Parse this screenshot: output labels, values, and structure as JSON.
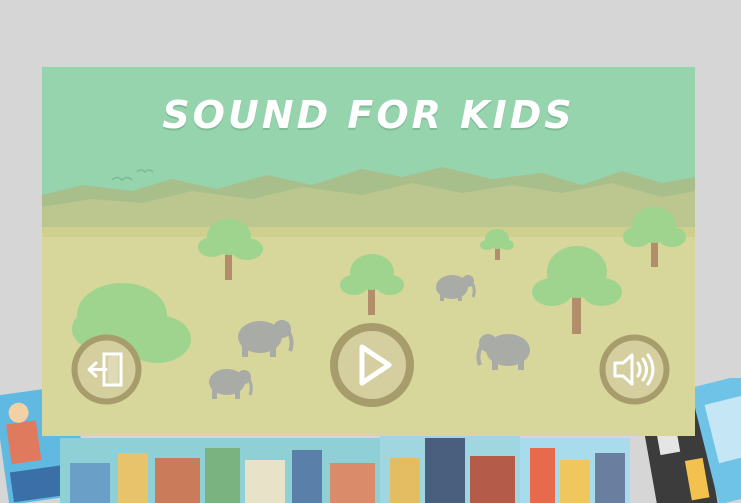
{
  "app": {
    "title": "SOUND FOR KIDS"
  },
  "buttons": {
    "exit": {
      "icon": "exit-door-icon"
    },
    "play": {
      "icon": "play-icon"
    },
    "sound": {
      "icon": "speaker-icon"
    }
  },
  "background_strip": {
    "description_icon": "city-game-thumbnails"
  },
  "colors": {
    "sky": "#95d4ad",
    "ground": "#d7d69b",
    "mountain": "#b3c28b",
    "tree_leaf": "#9ed48d",
    "trunk": "#b38e6b",
    "button_ring": "#a79d6c",
    "button_fill": "#d5cfa0",
    "elephant": "#a9aba6",
    "page_bg": "#d6d6d6"
  }
}
